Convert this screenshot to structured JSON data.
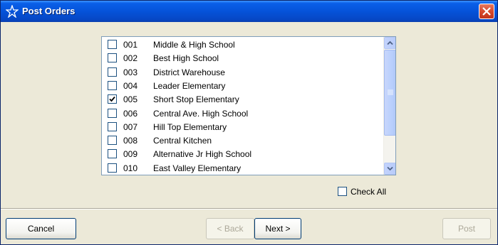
{
  "window": {
    "title": "Post Orders",
    "icon": "star-sparkle-icon",
    "close_icon": "close-x-icon"
  },
  "sites": [
    {
      "code": "001",
      "name": "Middle & High School",
      "checked": false
    },
    {
      "code": "002",
      "name": "Best High School",
      "checked": false
    },
    {
      "code": "003",
      "name": "District Warehouse",
      "checked": false
    },
    {
      "code": "004",
      "name": "Leader Elementary",
      "checked": false
    },
    {
      "code": "005",
      "name": "Short Stop Elementary",
      "checked": true
    },
    {
      "code": "006",
      "name": "Central Ave. High School",
      "checked": false
    },
    {
      "code": "007",
      "name": "Hill Top Elementary",
      "checked": false
    },
    {
      "code": "008",
      "name": "Central Kitchen",
      "checked": false
    },
    {
      "code": "009",
      "name": "Alternative Jr High School",
      "checked": false
    },
    {
      "code": "010",
      "name": "East Valley Elementary",
      "checked": false
    }
  ],
  "check_all": {
    "label": "Check All",
    "checked": false
  },
  "buttons": {
    "cancel": "Cancel",
    "back": "< Back",
    "next": "Next >",
    "post": "Post"
  }
}
